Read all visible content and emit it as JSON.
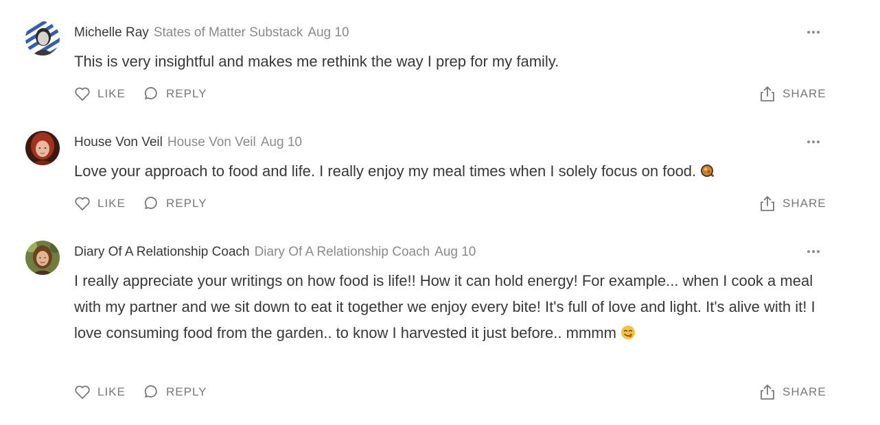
{
  "comments": [
    {
      "author": "Michelle Ray",
      "publication": "States of Matter Substack",
      "date": "Aug 10",
      "text": "This is very insightful and makes me rethink the way I prep for my family.",
      "emoji": "",
      "avatar_icon": "avatar-woman-striped-background"
    },
    {
      "author": "House Von Veil",
      "publication": "House Von Veil",
      "date": "Aug 10",
      "text": "Love your approach to food and life. I really enjoy my meal times when I solely focus on food.",
      "emoji": "pan-food-emoji",
      "avatar_icon": "avatar-woman-red-hair"
    },
    {
      "author": "Diary Of A Relationship Coach",
      "publication": "Diary Of A Relationship Coach",
      "date": "Aug 10",
      "text": "I really appreciate your writings on how food is life!! How it can hold energy! For example... when I cook a meal with my partner and we sit down to eat it together we enjoy every bite! It's full of love and light. It's alive with it! I love consuming food from the garden.. to know I harvested it just before.. mmmm",
      "emoji": "yum-face-emoji",
      "avatar_icon": "avatar-woman-outdoors"
    }
  ],
  "actions": {
    "like": "LIKE",
    "reply": "REPLY",
    "share": "SHARE"
  },
  "colors": {
    "text": "#363737",
    "muted": "#8a8a8a",
    "action": "#777777"
  }
}
